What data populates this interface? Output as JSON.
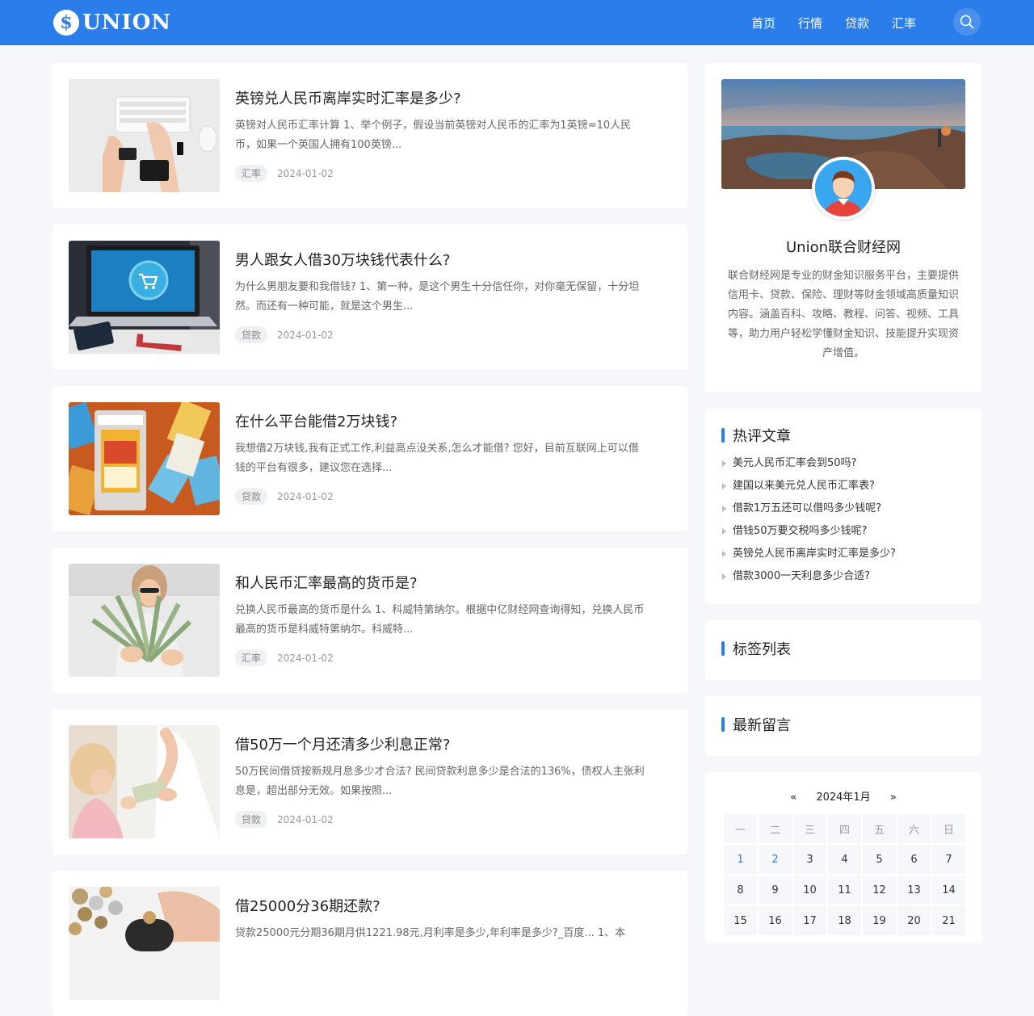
{
  "header": {
    "logo_symbol": "$",
    "logo_text": "UNION",
    "nav": [
      "首页",
      "行情",
      "贷款",
      "汇率"
    ]
  },
  "articles": [
    {
      "title": "英镑兑人民币离岸实时汇率是多少?",
      "excerpt": "英镑对人民币汇率计算 1、举个例子，假设当前英镑对人民币的汇率为1英镑=10人民币，如果一个英国人拥有100英镑...",
      "tag": "汇率",
      "date": "2024-01-02"
    },
    {
      "title": "男人跟女人借30万块钱代表什么?",
      "excerpt": "为什么男朋友要和我借钱? 1、第一种，是这个男生十分信任你，对你毫无保留，十分坦然。而还有一种可能，就是这个男生...",
      "tag": "贷款",
      "date": "2024-01-02"
    },
    {
      "title": "在什么平台能借2万块钱?",
      "excerpt": "我想借2万块钱,我有正式工作,利益高点没关系,怎么才能借? 您好，目前互联网上可以借钱的平台有很多，建议您在选择...",
      "tag": "贷款",
      "date": "2024-01-02"
    },
    {
      "title": "和人民币汇率最高的货币是?",
      "excerpt": "兑换人民币最高的货币是什么 1、科威特第纳尔。根据中亿财经网查询得知，兑换人民币最高的货币是科威特第纳尔。科威特...",
      "tag": "汇率",
      "date": "2024-01-02"
    },
    {
      "title": "借50万一个月还清多少利息正常?",
      "excerpt": "50万民间借贷按新规月息多少才合法? 民间贷款利息多少是合法的136%，债权人主张利息是，超出部分无效。如果按照...",
      "tag": "贷款",
      "date": "2024-01-02"
    },
    {
      "title": "借25000分36期还款?",
      "excerpt": "贷款25000元分期36期月供1221.98元,月利率是多少,年利率是多少?_百度... 1、本",
      "tag": "",
      "date": ""
    }
  ],
  "profile": {
    "name": "Union联合财经网",
    "description": "联合财经网是专业的财金知识服务平台，主要提供信用卡、贷款、保险、理财等财金领域高质量知识内容。涵盖百科、攻略、教程、问答、视频、工具等，助力用户轻松学懂财金知识、技能提升实现资产增值。"
  },
  "hot": {
    "title": "热评文章",
    "items": [
      "美元人民币汇率会到50吗?",
      "建国以来美元兑人民币汇率表?",
      "借款1万五还可以借吗多少钱呢?",
      "借钱50万要交税吗多少钱呢?",
      "英镑兑人民币离岸实时汇率是多少?",
      "借款3000一天利息多少合适?"
    ]
  },
  "tags_widget": {
    "title": "标签列表"
  },
  "comments_widget": {
    "title": "最新留言"
  },
  "calendar": {
    "prev": "«",
    "month": "2024年1月",
    "next": "»",
    "weekdays": [
      "一",
      "二",
      "三",
      "四",
      "五",
      "六",
      "日"
    ],
    "weeks": [
      [
        "1",
        "2",
        "3",
        "4",
        "5",
        "6",
        "7"
      ],
      [
        "8",
        "9",
        "10",
        "11",
        "12",
        "13",
        "14"
      ],
      [
        "15",
        "16",
        "17",
        "18",
        "19",
        "20",
        "21"
      ]
    ],
    "linked_days": [
      "1",
      "2"
    ]
  },
  "colors": {
    "brand": "#2b7de9",
    "background": "#f5f7fa"
  }
}
